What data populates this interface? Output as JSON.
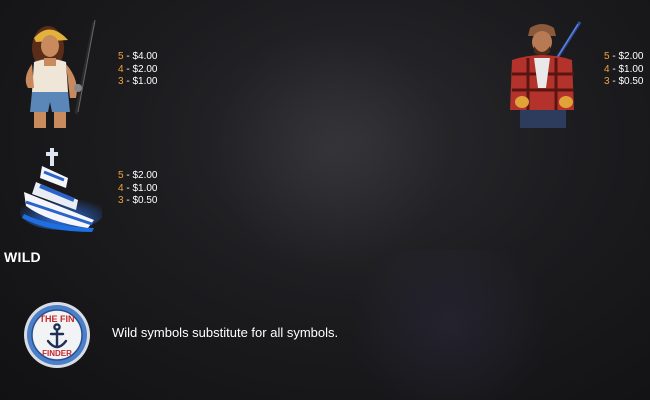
{
  "symbols": [
    {
      "name": "fisher-woman",
      "payouts": [
        {
          "count": "5",
          "sep": " - ",
          "amount": "$4.00"
        },
        {
          "count": "4",
          "sep": " - ",
          "amount": "$2.00"
        },
        {
          "count": "3",
          "sep": " - ",
          "amount": "$1.00"
        }
      ]
    },
    {
      "name": "fisher-man",
      "payouts": [
        {
          "count": "5",
          "sep": " - ",
          "amount": "$2.00"
        },
        {
          "count": "4",
          "sep": " - ",
          "amount": "$1.00"
        },
        {
          "count": "3",
          "sep": " - ",
          "amount": "$0.50"
        }
      ]
    },
    {
      "name": "yacht",
      "payouts": [
        {
          "count": "5",
          "sep": " - ",
          "amount": "$2.00"
        },
        {
          "count": "4",
          "sep": " - ",
          "amount": "$1.00"
        },
        {
          "count": "3",
          "sep": " - ",
          "amount": "$0.50"
        }
      ]
    }
  ],
  "wild": {
    "title": "WILD",
    "description": "Wild symbols substitute for all symbols.",
    "badge_text_top": "THE FIN",
    "badge_text_bottom": "FINDER"
  },
  "colors": {
    "count": "#f2a33a",
    "text": "#ffffff"
  }
}
